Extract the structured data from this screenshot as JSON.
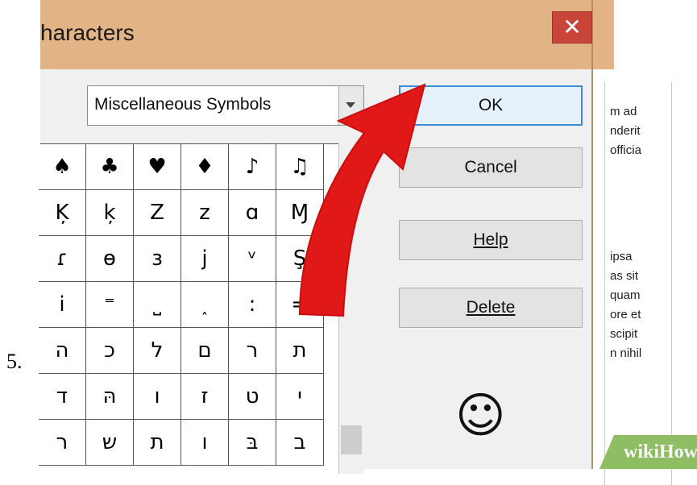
{
  "step_number": "5.",
  "dialog": {
    "title": "haracters",
    "close_icon": "close-icon",
    "font_select_value": "Miscellaneous Symbols",
    "buttons": {
      "ok": "OK",
      "cancel": "Cancel",
      "help": "Help",
      "delete": "Delete"
    },
    "preview_char": "☺",
    "grid": [
      [
        "♠",
        "♣",
        "♥",
        "♦",
        "♪",
        "♫"
      ],
      [
        "Ķ",
        "ķ",
        "Z",
        "z",
        "ɑ",
        "Ɱ"
      ],
      [
        "ɾ",
        "ɵ",
        "ɜ",
        "j",
        "ᵛ",
        "Ş"
      ],
      [
        "i",
        "⁼",
        "˽",
        "˰",
        ":",
        "="
      ],
      [
        "ה",
        "כ",
        "ל",
        "ם",
        "ר",
        "ת"
      ],
      [
        "ד",
        "הּ",
        "ו",
        "ז",
        "ט",
        "י"
      ],
      [
        "ר",
        "ש",
        "ת",
        "ו",
        "בּ",
        "ב"
      ]
    ]
  },
  "background_doc_lines": [
    "m ad",
    "nderit",
    "officia",
    "ipsa",
    "as sit",
    "quam",
    "ore et",
    "scipit",
    "n nihil"
  ],
  "watermark": "wikiHow",
  "colors": {
    "titlebar": "#e1b385",
    "close": "#c9453a",
    "ok_border": "#3b8ad6",
    "arrow": "#e01818"
  }
}
